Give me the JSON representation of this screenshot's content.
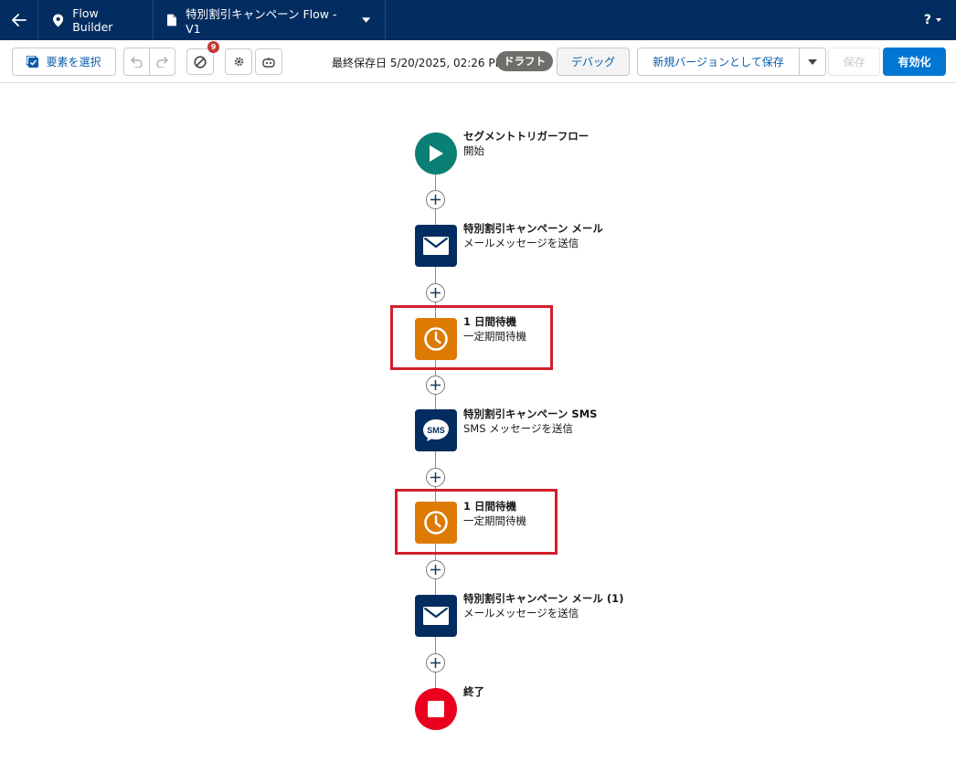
{
  "topbar": {
    "app_name": "Flow Builder",
    "flow_name": "特別割引キャンペーン Flow - V1",
    "help": "?"
  },
  "toolbar": {
    "select_elements": "要素を選択",
    "error_count": "9",
    "last_saved": "最終保存日 5/20/2025, 02:26 PM",
    "status": "ドラフト",
    "debug": "デバッグ",
    "save_as_new": "新規バージョンとして保存",
    "save": "保存",
    "activate": "有効化"
  },
  "flow": {
    "nodes": [
      {
        "title": "セグメントトリガーフロー",
        "subtitle": "開始",
        "icon": "play-icon"
      },
      {
        "title": "特別割引キャンペーン メール",
        "subtitle": "メールメッセージを送信",
        "icon": "envelope-icon"
      },
      {
        "title": "1 日間待機",
        "subtitle": "一定期間待機",
        "icon": "clock-icon"
      },
      {
        "title": "特別割引キャンペーン SMS",
        "subtitle": "SMS メッセージを送信",
        "icon": "sms-icon"
      },
      {
        "title": "1 日間待機",
        "subtitle": "一定期間待機",
        "icon": "clock-icon"
      },
      {
        "title": "特別割引キャンペーン メール (1)",
        "subtitle": "メールメッセージを送信",
        "icon": "envelope-icon"
      },
      {
        "title": "終了",
        "subtitle": "",
        "icon": "stop-icon"
      }
    ]
  },
  "colors": {
    "nav": "#032d60",
    "start": "#0a7f74",
    "message": "#032d60",
    "wait": "#dd7a01",
    "end": "#ea001e",
    "activate": "#0176d3",
    "highlight": "#d11f2b"
  }
}
